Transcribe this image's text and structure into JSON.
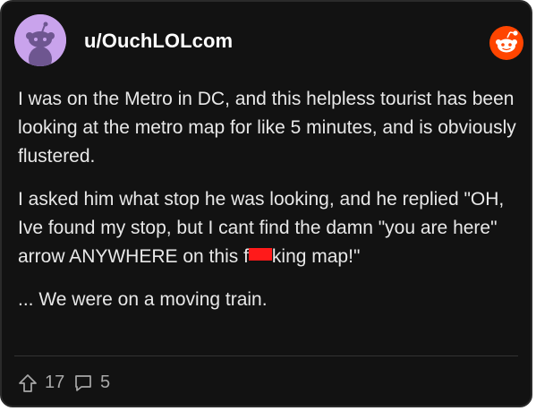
{
  "post": {
    "username": "u/OuchLOLcom",
    "paragraphs": {
      "p1": "I was on the Metro in DC, and this helpless tourist has been looking at the metro map for like 5 minutes, and is obviously flustered.",
      "p2_before": "I asked him what stop he was looking, and he replied \"OH, Ive found my stop, but I cant find the damn \"you are here\" arrow ANYWHERE on this f",
      "p2_after": "king map!\"",
      "p3": "... We were on a moving train."
    },
    "upvotes": "17",
    "comments": "5"
  },
  "colors": {
    "background": "#121212",
    "avatar": "#c9a3ec",
    "reddit_orange": "#ff4500",
    "redaction": "#ff1a1a"
  },
  "icons": {
    "avatar": "snoo-avatar-icon",
    "logo": "reddit-logo-icon",
    "upvote": "upvote-arrow-icon",
    "comment": "comment-bubble-icon"
  }
}
